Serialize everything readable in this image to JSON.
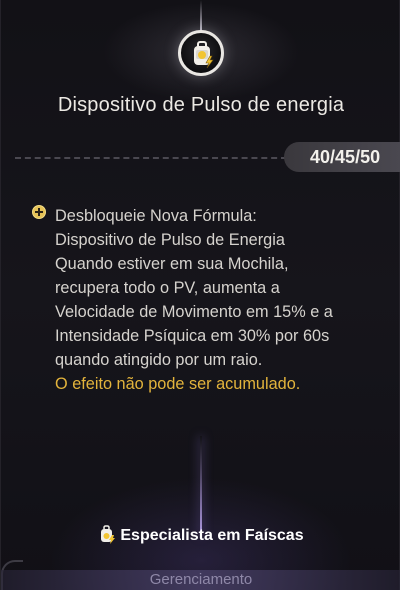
{
  "item": {
    "title": "Dispositivo de Pulso de energia",
    "icon": "backpack-lightning-icon"
  },
  "counter": {
    "current": "40",
    "middle": "45",
    "max": "50",
    "separator": "/"
  },
  "description": {
    "icon": "plus-circle-icon",
    "lines": [
      "Desbloqueie Nova Fórmula:",
      "Dispositivo de Pulso de Energia",
      "Quando estiver em sua Mochila,",
      "recupera todo o PV, aumenta a",
      "Velocidade de Movimento em 15% e a",
      "Intensidade Psíquica em 30% por 60s",
      "quando atingido por um raio."
    ],
    "warning": "O efeito não pode ser acumulado."
  },
  "specialist": {
    "label": "Especialista em Faíscas",
    "icon": "backpack-lightning-icon"
  },
  "management": {
    "label": "Gerenciamento"
  },
  "colors": {
    "warning": "#e3b43c",
    "plus_icon": "#e6c357",
    "background": "#0b0a0e"
  }
}
